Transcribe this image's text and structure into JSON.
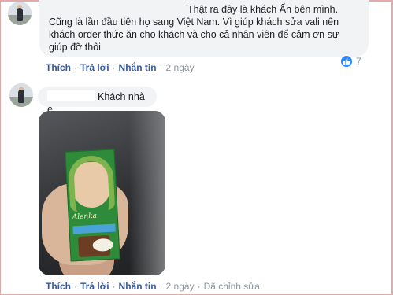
{
  "comment1": {
    "lines": [
      "Thật ra đây là khách Ấn bên mình.",
      "Cũng là lần đầu tiên họ sang Việt Nam. Vì giúp khách sửa vali nên",
      "khách order thức ăn cho khách và cho cả nhân viên để cảm ơn sự",
      "giúp đỡ thôi"
    ],
    "actions": {
      "like": "Thích",
      "reply": "Trả lời",
      "message": "Nhắn tin",
      "time": "2 ngày"
    },
    "reaction": {
      "icon": "like-icon",
      "count": "7",
      "color": "#2d88ff"
    }
  },
  "comment2": {
    "text": "Khách nhà e",
    "actions": {
      "like": "Thích",
      "reply": "Trả lời",
      "message": "Nhắn tin",
      "time": "2 ngày",
      "edited": "Đã chỉnh sửa"
    },
    "photo_brand": "Alenka"
  },
  "colors": {
    "link": "#385898",
    "bubble": "#f2f3f5",
    "muted": "#8d949e"
  }
}
